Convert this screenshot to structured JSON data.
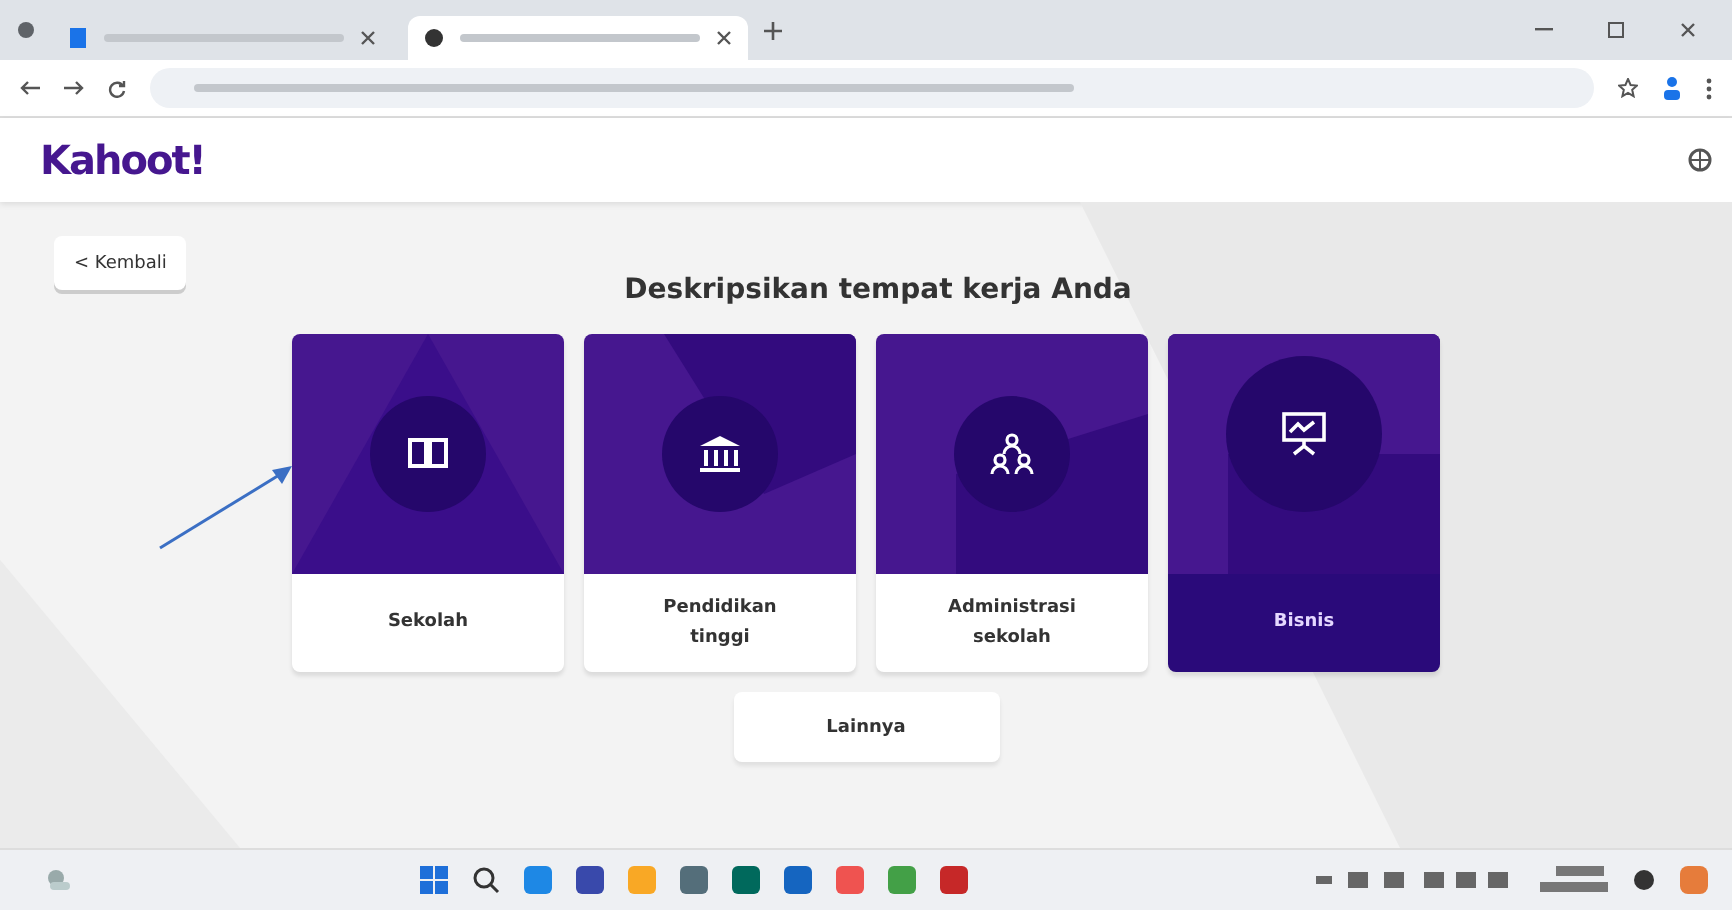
{
  "header": {
    "logo": "Kahoot!"
  },
  "back_button": {
    "label": "< Kembali"
  },
  "title": "Deskripsikan tempat kerja Anda",
  "cards": [
    {
      "label": "Sekolah",
      "kind": "book",
      "selected": false
    },
    {
      "label": "Pendidikan tinggi",
      "kind": "building",
      "selected": false
    },
    {
      "label": "Administrasi sekolah",
      "kind": "people",
      "selected": false
    },
    {
      "label": "Bisnis",
      "kind": "presentation",
      "selected": true
    }
  ],
  "other_button": {
    "label": "Lainnya"
  }
}
